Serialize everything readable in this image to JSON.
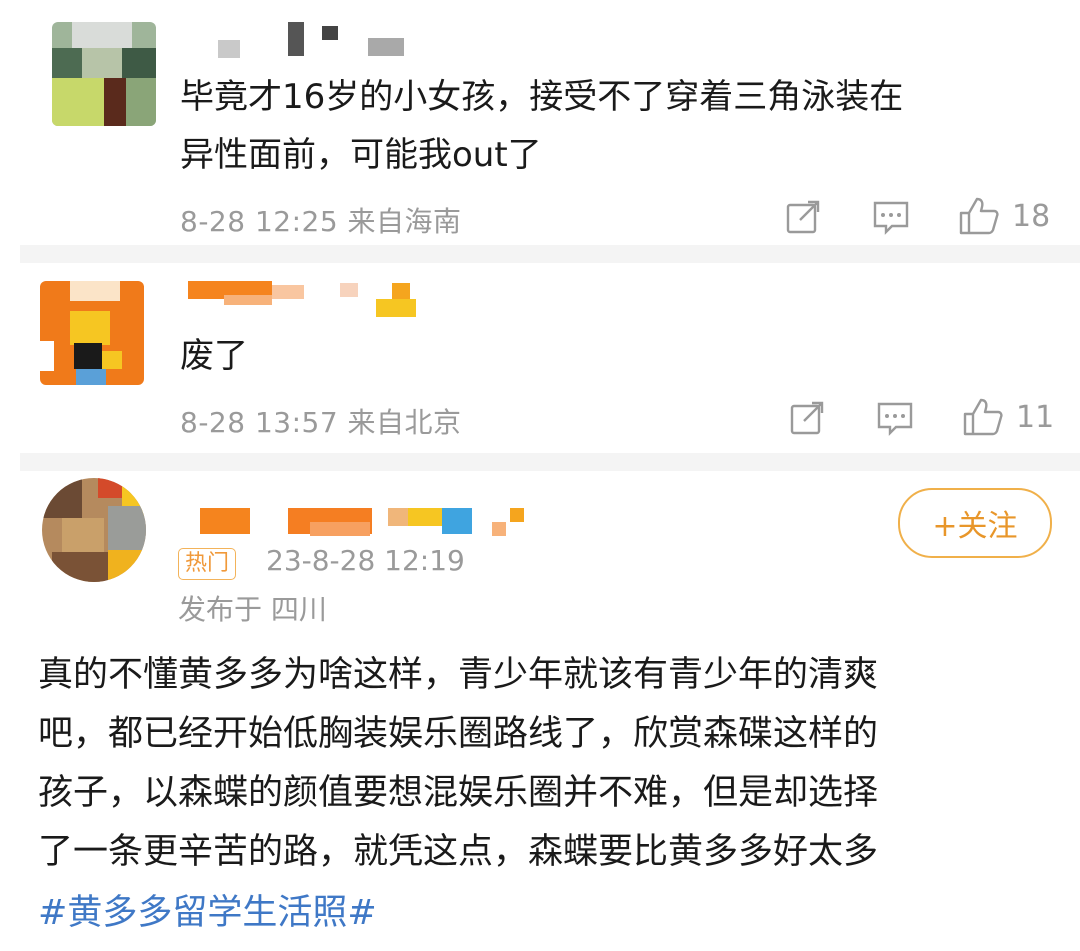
{
  "comments": [
    {
      "text_line1": "毕竟才16岁的小女孩，接受不了穿着三角泳装在",
      "text_line2": "异性面前，可能我out了",
      "time": "8-28 12:25",
      "location": "来自海南",
      "like_count": "18"
    },
    {
      "text_line1": "废了",
      "time": "8-28 13:57",
      "location": "来自北京",
      "like_count": "11"
    }
  ],
  "post": {
    "follow_label": "+关注",
    "hot_badge": "热门",
    "time": "23-8-28 12:19",
    "location": "发布于 四川",
    "lines": [
      "真的不懂黄多多为啥这样，青少年就该有青少年的清爽",
      "吧，都已经开始低胸装娱乐圈路线了，欣赏森碟这样的",
      "孩子，以森蝶的颜值要想混娱乐圈并不难，但是却选择",
      "了一条更辛苦的路，就凭这点，森蝶要比黄多多好太多"
    ],
    "hashtag": "#黄多多留学生活照#"
  },
  "icons": {
    "repost": "repost-icon",
    "reply": "comment-icon",
    "like": "like-icon"
  },
  "colors": {
    "meta_gray": "#9a9a9a",
    "follow_orange": "#e8962a",
    "hashtag_blue": "#3f78c6"
  }
}
